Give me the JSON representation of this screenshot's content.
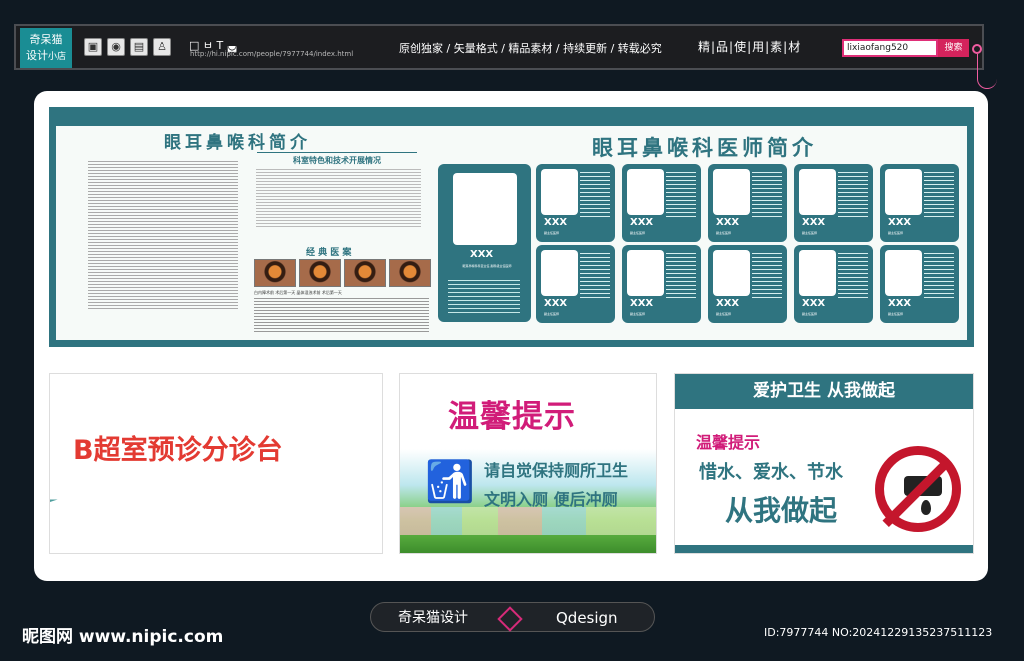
{
  "topbar": {
    "logo_line1": "奇呆猫",
    "logo_line2": "设计",
    "logo_sub": "小店",
    "tool_icons": [
      "gift-icon",
      "camera-icon",
      "clipboard-icon",
      "flask-icon"
    ],
    "mini_tools": "□ ㅂ T ◛",
    "url": "http://hi.nipic.com/people/7977744/index.html",
    "slogan": "原创独家 / 矢量格式 / 精品素材 / 持续更新 / 转载必究",
    "quality": "精|品|使|用|素|材",
    "search_value": "lixiaofang520",
    "search_button": "搜索"
  },
  "board": {
    "left_title": "眼耳鼻喉科简介",
    "right_title": "眼耳鼻喉科医师简介",
    "feature_caption": "科室特色和技术开展情况",
    "case_title": "经 典 医 案",
    "case_caption": "白内障术前   术后第一天   晶体混浊术前   术后第一天",
    "main_name": "XXX",
    "main_desc": "眼耳鼻喉科科室主任 \n 副科级主任医师",
    "doctor_name": "XXX",
    "doctor_desc": "副主任医师"
  },
  "panels": {
    "b_text": "B超室预诊分诊台",
    "tip_title": "温馨提示",
    "tip_line1": "请自觉保持厕所卫生",
    "tip_line2": "文明入厕  便后冲厕",
    "care_title": "爱护卫生  从我做起",
    "care_small": "温馨提示",
    "care_text": "惜水、爱水、节水",
    "care_big": "从我做起"
  },
  "footer": {
    "logo": "奇呆猫设计",
    "brand": "Qdesign",
    "left": "昵图网 www.nipic.com",
    "id": "ID:7977744 NO:20241229135237511123"
  }
}
